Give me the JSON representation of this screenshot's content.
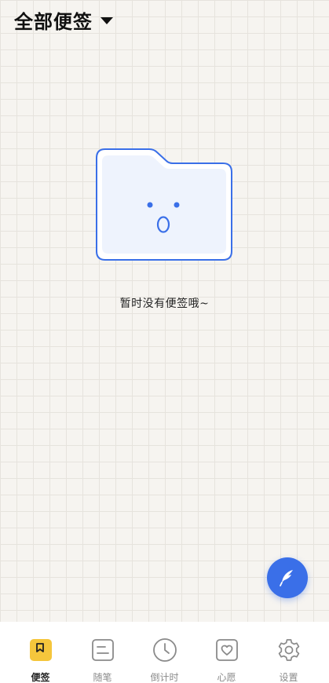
{
  "header": {
    "title": "全部便签",
    "dropdown_icon": "caret-down-icon"
  },
  "empty_state": {
    "illustration": "surprised-folder-icon",
    "message": "暂时没有便签哦~"
  },
  "fab": {
    "icon": "feather-icon",
    "color": "#3a6fe8"
  },
  "bottom_nav": {
    "items": [
      {
        "label": "便签",
        "icon": "bookmark-note-icon",
        "active": true
      },
      {
        "label": "随笔",
        "icon": "notebook-icon",
        "active": false
      },
      {
        "label": "倒计时",
        "icon": "clock-icon",
        "active": false
      },
      {
        "label": "心愿",
        "icon": "heart-icon",
        "active": false
      },
      {
        "label": "设置",
        "icon": "gear-icon",
        "active": false
      }
    ]
  },
  "colors": {
    "accent": "#3a6fe8",
    "active_tab": "#f5c63c",
    "background": "#f6f4f0"
  }
}
